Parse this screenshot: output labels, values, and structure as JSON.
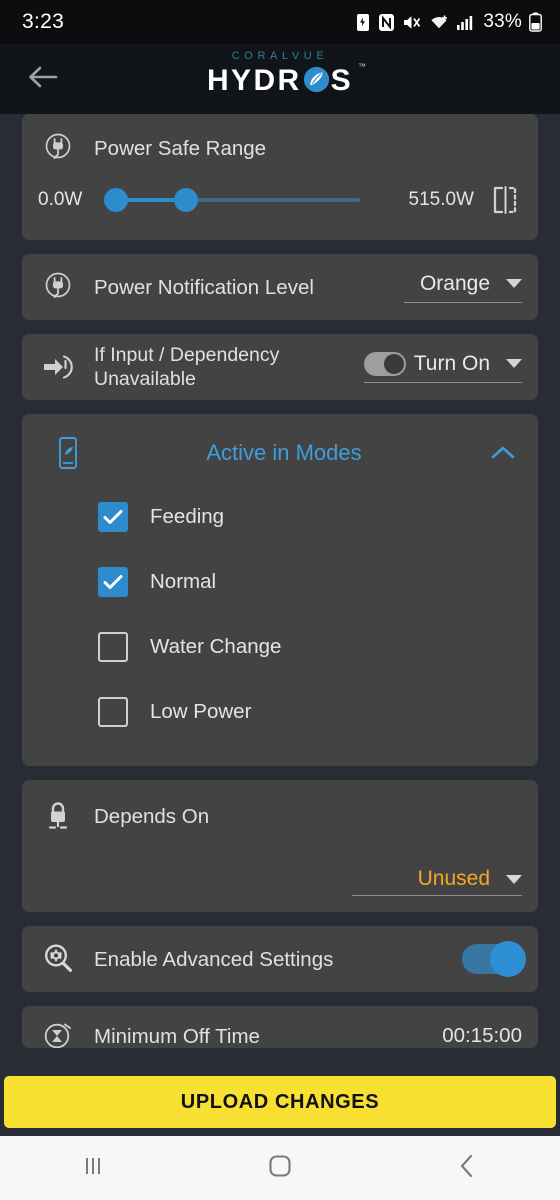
{
  "status_bar": {
    "time": "3:23",
    "battery_percent": "33%",
    "icons": [
      "battery-saver-icon",
      "nfc-icon",
      "mute-icon",
      "wifi-icon",
      "cellular-signal-icon",
      "battery-icon"
    ]
  },
  "app_bar": {
    "back_icon": "back-arrow-icon",
    "brand_top": "CORALVUE",
    "brand_left": "HYDR",
    "brand_right": "S",
    "brand_tm": "™"
  },
  "power_safe_range": {
    "icon": "power-plug-icon",
    "title": "Power Safe Range",
    "min_value": "0.0W",
    "max_value": "515.0W",
    "copy_icon": "mirror-split-icon",
    "slider": {
      "lower_thumb_pct": 0,
      "upper_thumb_pct": 21
    }
  },
  "power_notification": {
    "icon": "power-plug-icon",
    "title": "Power Notification Level",
    "value": "Orange",
    "caret_icon": "chevron-down-icon"
  },
  "input_dependency": {
    "icon": "input-arrow-icon",
    "title": "If Input / Dependency Unavailable",
    "value": "Turn On",
    "toggle_on": false,
    "caret_icon": "chevron-down-icon"
  },
  "active_in_modes": {
    "icon": "device-mode-icon",
    "title": "Active in Modes",
    "collapse_icon": "chevron-up-icon",
    "modes": [
      {
        "label": "Feeding",
        "checked": true
      },
      {
        "label": "Normal",
        "checked": true
      },
      {
        "label": "Water Change",
        "checked": false
      },
      {
        "label": "Low Power",
        "checked": false
      }
    ]
  },
  "depends_on": {
    "icon": "lock-icon",
    "title": "Depends On",
    "value": "Unused",
    "value_color": "#f5a623",
    "caret_icon": "chevron-down-icon"
  },
  "advanced_settings": {
    "icon": "settings-search-icon",
    "title": "Enable Advanced Settings",
    "toggle_on": true
  },
  "minimum_off_time": {
    "icon": "hourglass-timer-icon",
    "title": "Minimum Off Time",
    "value": "00:15:00"
  },
  "upload": {
    "label": "UPLOAD CHANGES",
    "color": "#f8e033"
  },
  "nav_bar": {
    "recents_icon": "recents-icon",
    "home_icon": "home-icon",
    "back_icon": "nav-back-icon"
  },
  "theme": {
    "page_bg": "#282c34",
    "card_bg": "#434343",
    "accent_blue": "#2e8bcc",
    "accent_orange": "#f5a623"
  }
}
